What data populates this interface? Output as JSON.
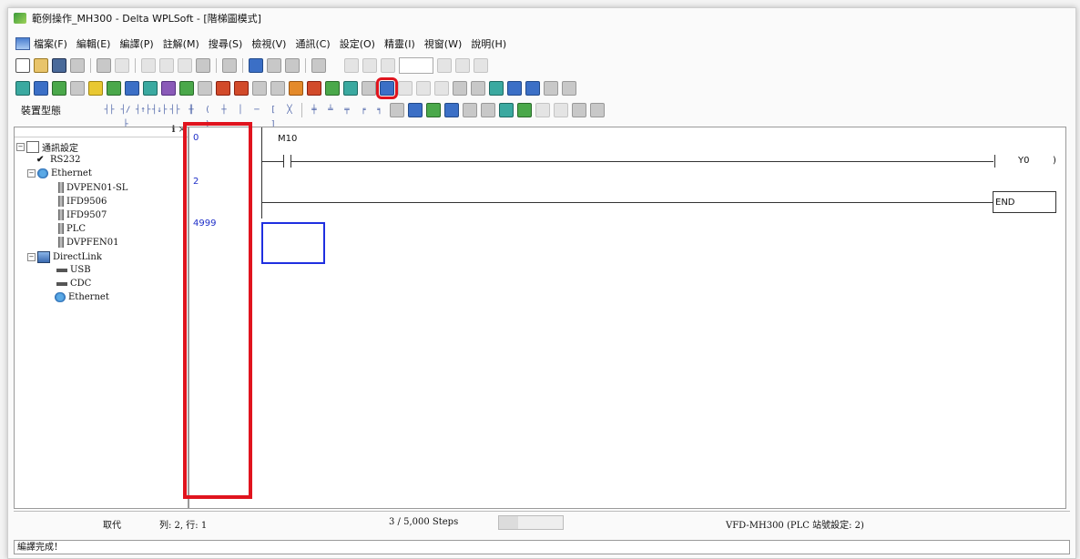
{
  "window": {
    "title": "範例操作_MH300 - Delta WPLSoft - [階梯圖模式]"
  },
  "menubar": {
    "items": [
      "檔案(F)",
      "編輯(E)",
      "編譯(P)",
      "註解(M)",
      "搜尋(S)",
      "檢視(V)",
      "通訊(C)",
      "設定(O)",
      "精靈(I)",
      "視窗(W)",
      "說明(H)"
    ]
  },
  "toolbar3": {
    "label": "裝置型態"
  },
  "tree": {
    "root": "通訊設定",
    "rs232": "RS232",
    "ethernet": "Ethernet",
    "eth_items": [
      "DVPEN01-SL",
      "IFD9506",
      "IFD9507",
      "PLC",
      "DVPFEN01"
    ],
    "directlink": "DirectLink",
    "dl_items": [
      "USB",
      "CDC",
      "Ethernet"
    ]
  },
  "ladder": {
    "steps": [
      "0",
      "2",
      "4999"
    ],
    "contact_label": "M10",
    "coil": "Y0",
    "end": "END"
  },
  "status": {
    "mode": "取代",
    "position": "列: 2, 行: 1",
    "steps": "3 / 5,000 Steps",
    "device": "VFD-MH300 (PLC 站號設定: 2)"
  },
  "message": "編譯完成！",
  "colors": {
    "highlight": "#e0141e",
    "step_numbers": "#1f2fc8",
    "cursor": "#1f2fe0"
  }
}
